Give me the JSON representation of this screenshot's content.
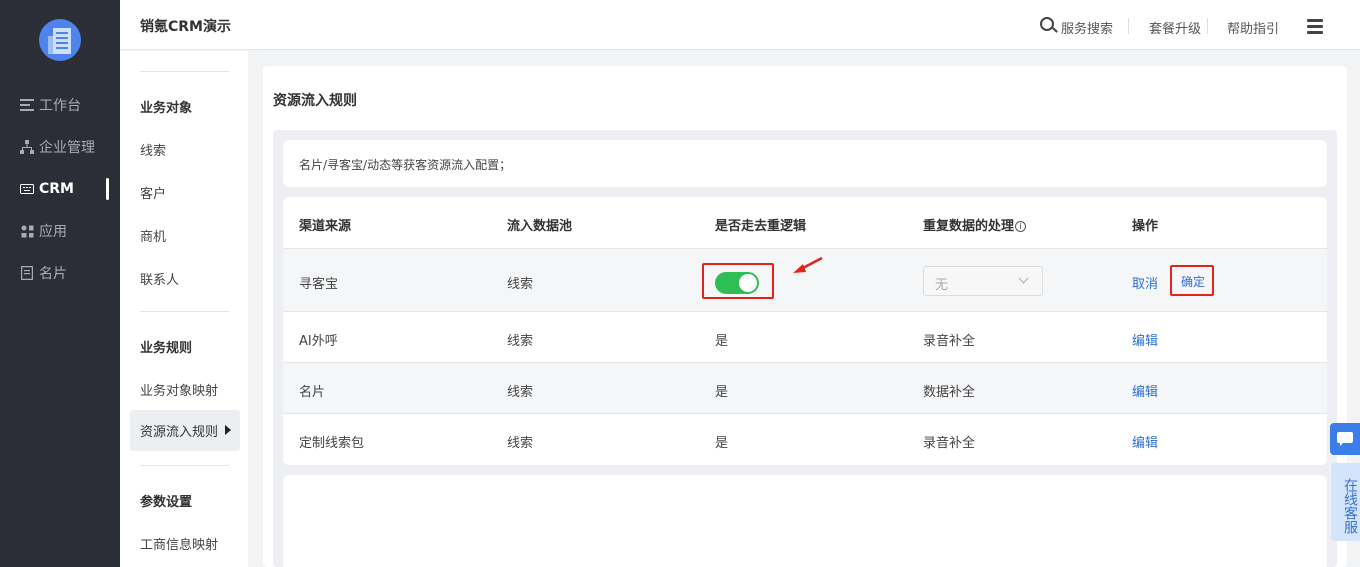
{
  "nav": {
    "items": [
      {
        "label": "工作台",
        "icon": "list-icon"
      },
      {
        "label": "企业管理",
        "icon": "org-chart-icon"
      },
      {
        "label": "CRM",
        "icon": "keyboard-icon"
      },
      {
        "label": "应用",
        "icon": "apps-icon"
      },
      {
        "label": "名片",
        "icon": "card-icon"
      }
    ],
    "active": "CRM"
  },
  "topbar": {
    "title": "销氪CRM演示",
    "search_label": "服务搜索",
    "upgrade_label": "套餐升级",
    "help_label": "帮助指引"
  },
  "subnav": {
    "group1": "业务对象",
    "group1_items": [
      "线索",
      "客户",
      "商机",
      "联系人"
    ],
    "group2": "业务规则",
    "group2_items": [
      "业务对象映射",
      "资源流入规则"
    ],
    "group3": "参数设置",
    "group3_items": [
      "工商信息映射"
    ],
    "active": "资源流入规则"
  },
  "panel": {
    "title": "资源流入规则",
    "notice": "名片/寻客宝/动态等获客资源流入配置；"
  },
  "table": {
    "columns": [
      "渠道来源",
      "流入数据池",
      "是否走去重逻辑",
      "重复数据的处理",
      "操作"
    ],
    "editing_row": {
      "source": "寻客宝",
      "pool": "线索",
      "dedupe_enabled": true,
      "handling_placeholder": "无",
      "cancel_label": "取消",
      "confirm_label": "确定"
    },
    "rows": [
      {
        "source": "AI外呼",
        "pool": "线索",
        "dedupe": "是",
        "handling": "录音补全",
        "action": "编辑"
      },
      {
        "source": "名片",
        "pool": "线索",
        "dedupe": "是",
        "handling": "数据补全",
        "action": "编辑"
      },
      {
        "source": "定制线索包",
        "pool": "线索",
        "dedupe": "是",
        "handling": "录音补全",
        "action": "编辑"
      }
    ]
  },
  "service": {
    "label": "在线客服"
  },
  "colors": {
    "nav_bg": "#2b2e37",
    "toggle_on": "#2fbd55",
    "link": "#2f6fd6",
    "highlight": "#e1251b"
  }
}
